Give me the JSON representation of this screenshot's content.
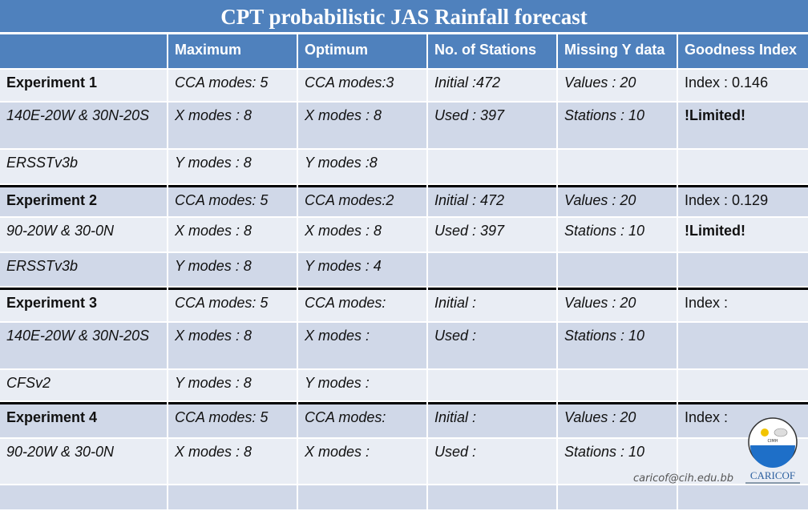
{
  "title": "CPT probabilistic JAS Rainfall forecast",
  "header": [
    "",
    "Maximum",
    "Optimum",
    "No. of Stations",
    "Missing Y data",
    "Goodness Index"
  ],
  "rows": [
    {
      "shade": "light",
      "sep": false,
      "h": 39,
      "cells": [
        {
          "t": "Experiment 1",
          "s": "b"
        },
        {
          "t": "CCA modes: 5",
          "s": "it"
        },
        {
          "t": "CCA modes:3",
          "s": "it"
        },
        {
          "t": "Initial :472",
          "s": "it"
        },
        {
          "t": "Values : 20",
          "s": "it"
        },
        {
          "t": "Index : 0.146",
          "s": ""
        }
      ]
    },
    {
      "shade": "dark",
      "sep": false,
      "h": 57,
      "cells": [
        {
          "t": "140E-20W & 30N-20S",
          "s": "it"
        },
        {
          "t": "X modes : 8",
          "s": "it"
        },
        {
          "t": "X modes : 8",
          "s": "it"
        },
        {
          "t": "Used : 397",
          "s": "it"
        },
        {
          "t": "Stations : 10",
          "s": "it"
        },
        {
          "t": "!Limited!",
          "s": "b"
        }
      ]
    },
    {
      "shade": "light",
      "sep": false,
      "h": 42,
      "cells": [
        {
          "t": "ERSSTv3b",
          "s": "it"
        },
        {
          "t": "Y modes : 8",
          "s": "it"
        },
        {
          "t": "Y modes :8",
          "s": "it"
        },
        {
          "t": "",
          "s": ""
        },
        {
          "t": "",
          "s": ""
        },
        {
          "t": "",
          "s": ""
        }
      ]
    },
    {
      "shade": "dark",
      "sep": true,
      "h": 36,
      "cells": [
        {
          "t": "Experiment 2",
          "s": "b"
        },
        {
          "t": "CCA modes: 5",
          "s": "it"
        },
        {
          "t": "CCA modes:2",
          "s": "it"
        },
        {
          "t": "Initial : 472",
          "s": "it"
        },
        {
          "t": "Values : 20",
          "s": "it"
        },
        {
          "t": "Index : 0.129",
          "s": ""
        }
      ]
    },
    {
      "shade": "light",
      "sep": false,
      "h": 42,
      "cells": [
        {
          "t": "90-20W & 30-0N",
          "s": "it"
        },
        {
          "t": "X modes : 8",
          "s": "it"
        },
        {
          "t": "X modes : 8",
          "s": "it"
        },
        {
          "t": "Used : 397",
          "s": "it"
        },
        {
          "t": "Stations : 10",
          "s": "it"
        },
        {
          "t": "!Limited!",
          "s": "b"
        }
      ]
    },
    {
      "shade": "dark",
      "sep": false,
      "h": 41,
      "cells": [
        {
          "t": "ERSSTv3b",
          "s": "it"
        },
        {
          "t": "Y modes : 8",
          "s": "it"
        },
        {
          "t": "Y modes : 4",
          "s": "it"
        },
        {
          "t": "",
          "s": ""
        },
        {
          "t": "",
          "s": ""
        },
        {
          "t": "",
          "s": ""
        }
      ]
    },
    {
      "shade": "light",
      "sep": true,
      "h": 39,
      "cells": [
        {
          "t": "Experiment 3",
          "s": "b"
        },
        {
          "t": "CCA modes: 5",
          "s": "it"
        },
        {
          "t": "CCA modes:",
          "s": "it"
        },
        {
          "t": "Initial :",
          "s": "it"
        },
        {
          "t": "Values : 20",
          "s": "it"
        },
        {
          "t": "Index :",
          "s": ""
        }
      ]
    },
    {
      "shade": "dark",
      "sep": false,
      "h": 57,
      "cells": [
        {
          "t": "140E-20W & 30N-20S",
          "s": "it"
        },
        {
          "t": "X modes : 8",
          "s": "it"
        },
        {
          "t": "X modes :",
          "s": "it"
        },
        {
          "t": "Used :",
          "s": "it"
        },
        {
          "t": "Stations : 10",
          "s": "it"
        },
        {
          "t": "",
          "s": ""
        }
      ]
    },
    {
      "shade": "light",
      "sep": false,
      "h": 38,
      "cells": [
        {
          "t": "CFSv2",
          "s": "it"
        },
        {
          "t": "Y modes : 8",
          "s": "it"
        },
        {
          "t": "Y modes :",
          "s": "it"
        },
        {
          "t": "",
          "s": ""
        },
        {
          "t": "",
          "s": ""
        },
        {
          "t": "",
          "s": ""
        }
      ]
    },
    {
      "shade": "dark",
      "sep": true,
      "h": 41,
      "cells": [
        {
          "t": "Experiment 4",
          "s": "b"
        },
        {
          "t": "CCA modes: 5",
          "s": "it"
        },
        {
          "t": "CCA modes:",
          "s": "it"
        },
        {
          "t": "Initial :",
          "s": "it"
        },
        {
          "t": "Values : 20",
          "s": "it"
        },
        {
          "t": "Index :",
          "s": ""
        }
      ]
    },
    {
      "shade": "light",
      "sep": false,
      "h": 56,
      "cells": [
        {
          "t": "90-20W & 30-0N",
          "s": "it"
        },
        {
          "t": "X modes : 8",
          "s": "it"
        },
        {
          "t": "X modes :",
          "s": "it"
        },
        {
          "t": "Used :",
          "s": "it"
        },
        {
          "t": "Stations : 10",
          "s": "it"
        },
        {
          "t": "",
          "s": ""
        }
      ]
    },
    {
      "shade": "dark",
      "sep": false,
      "h": 30,
      "cells": [
        {
          "t": "",
          "s": ""
        },
        {
          "t": "",
          "s": ""
        },
        {
          "t": "",
          "s": ""
        },
        {
          "t": "",
          "s": ""
        },
        {
          "t": "",
          "s": ""
        },
        {
          "t": "",
          "s": ""
        }
      ]
    }
  ],
  "footer": {
    "email": "caricof@cih.edu.bb",
    "logo_text": "CARICOF",
    "logo_ring_text": "CIMH"
  },
  "colors": {
    "header_blue": "#4f81bd",
    "row_light": "#e9edf4",
    "row_dark": "#d0d8e8"
  }
}
